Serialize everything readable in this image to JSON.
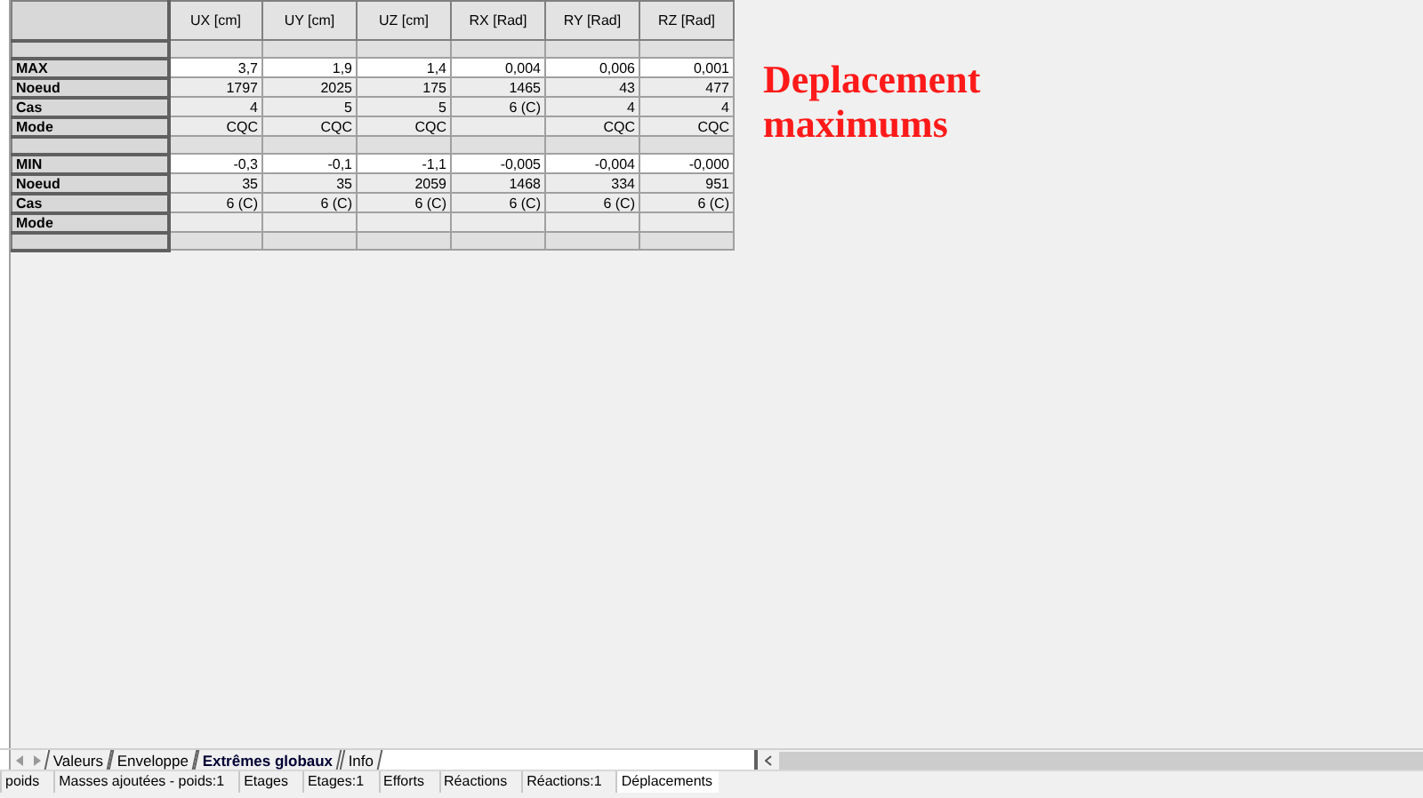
{
  "table": {
    "columns": [
      "UX [cm]",
      "UY [cm]",
      "UZ [cm]",
      "RX [Rad]",
      "RY [Rad]",
      "RZ [Rad]"
    ],
    "rows": [
      {
        "kind": "spacer"
      },
      {
        "kind": "extreme",
        "label": "MAX",
        "cells": [
          "3,7",
          "1,9",
          "1,4",
          "0,004",
          "0,006",
          "0,001"
        ]
      },
      {
        "kind": "data",
        "label": "Noeud",
        "cells": [
          "1797",
          "2025",
          "175",
          "1465",
          "43",
          "477"
        ]
      },
      {
        "kind": "data",
        "label": "Cas",
        "cells": [
          "4",
          "5",
          "5",
          "6 (C)",
          "4",
          "4"
        ]
      },
      {
        "kind": "data",
        "label": "Mode",
        "cells": [
          "CQC",
          "CQC",
          "CQC",
          null,
          "CQC",
          "CQC"
        ]
      },
      {
        "kind": "spacer"
      },
      {
        "kind": "extreme",
        "label": "MIN",
        "cells": [
          "-0,3",
          "-0,1",
          "-1,1",
          "-0,005",
          "-0,004",
          "-0,000"
        ]
      },
      {
        "kind": "data",
        "label": "Noeud",
        "cells": [
          "35",
          "35",
          "2059",
          "1468",
          "334",
          "951"
        ]
      },
      {
        "kind": "data",
        "label": "Cas",
        "cells": [
          "6 (C)",
          "6 (C)",
          "6 (C)",
          "6 (C)",
          "6 (C)",
          "6 (C)"
        ]
      },
      {
        "kind": "data",
        "label": "Mode",
        "cells": [
          null,
          null,
          null,
          null,
          null,
          null
        ]
      },
      {
        "kind": "spacer"
      }
    ]
  },
  "annotation": [
    "Deplacement",
    "maximums"
  ],
  "tabs": [
    {
      "label": "Valeurs",
      "selected": false
    },
    {
      "label": "Enveloppe",
      "selected": false
    },
    {
      "label": "Extrêmes globaux",
      "selected": true
    },
    {
      "label": "Info",
      "selected": false
    }
  ],
  "status_bar": [
    {
      "label": "poids",
      "selected": false
    },
    {
      "label": "Masses ajoutées - poids:1",
      "selected": false
    },
    {
      "label": "Etages",
      "selected": false
    },
    {
      "label": "Etages:1",
      "selected": false
    },
    {
      "label": "Efforts",
      "selected": false
    },
    {
      "label": "Réactions",
      "selected": false
    },
    {
      "label": "Réactions:1",
      "selected": false
    },
    {
      "label": "Déplacements",
      "selected": true
    }
  ]
}
